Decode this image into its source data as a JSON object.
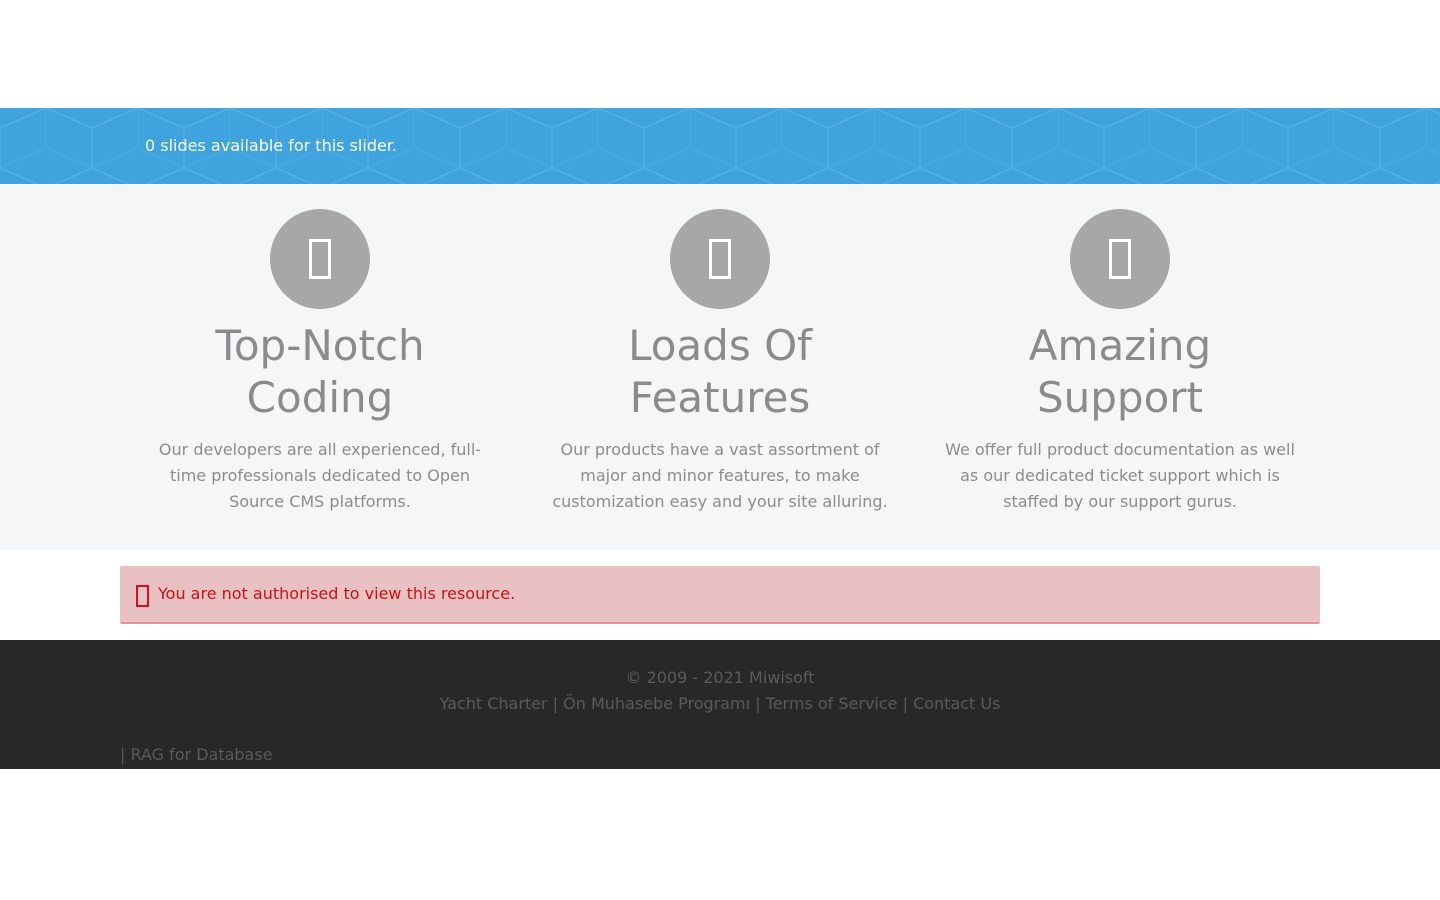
{
  "colors": {
    "slider_bg": "#3fa3de",
    "features_bg": "#f4f6f8",
    "icon_circle": "#a7a7a9",
    "alert_bg": "#e9c1c2",
    "alert_text": "#cc1111",
    "footer_bg": "#282828"
  },
  "slider": {
    "message": "0 slides available for this slider."
  },
  "features": [
    {
      "icon": "missing-glyph-icon",
      "title": "Top-Notch Coding",
      "text": "Our developers are all experienced, full-time professionals dedicated to Open Source CMS platforms."
    },
    {
      "icon": "missing-glyph-icon",
      "title": "Loads Of Features",
      "text": "Our products have a vast assortment of major and minor features, to make customization easy and your site alluring."
    },
    {
      "icon": "missing-glyph-icon",
      "title": "Amazing Support",
      "text": "We offer full product documentation as well as our dedicated ticket support which is staffed by our support gurus."
    }
  ],
  "alert": {
    "icon": "warning-glyph-icon",
    "message": "You are not authorised to view this resource."
  },
  "footer": {
    "copyright": "© 2009 - 2021 Miwisoft",
    "separator": " | ",
    "links": [
      "Yacht Charter",
      "Ön Muhasebe Programı",
      "Terms of Service",
      "Contact Us"
    ],
    "extra_prefix": "| ",
    "extra_link": "RAG for Database"
  }
}
